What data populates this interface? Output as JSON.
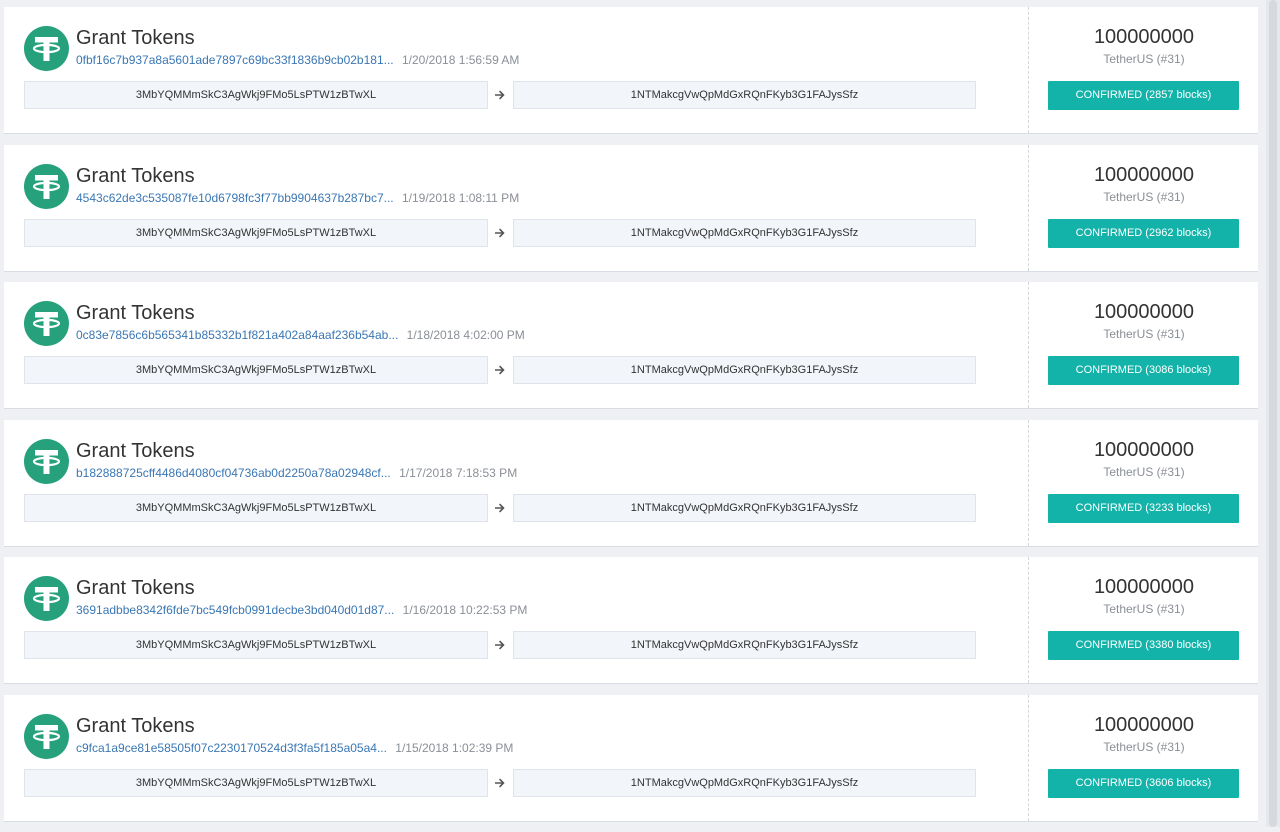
{
  "colors": {
    "tether_green": "#26a17b",
    "confirmed_teal": "#13b3a9",
    "hash_link": "#3a77b4"
  },
  "icons": {
    "logo": "tether-logo-icon",
    "arrow": "arrow-right-icon"
  },
  "transactions": [
    {
      "type": "Grant Tokens",
      "hash": "0fbf16c7b937a8a5601ade7897c69bc33f1836b9cb02b181...",
      "time": "1/20/2018 1:56:59 AM",
      "from": "3MbYQMMmSkC3AgWkj9FMo5LsPTW1zBTwXL",
      "to": "1NTMakcgVwQpMdGxRQnFKyb3G1FAJysSfz",
      "amount": "100000000",
      "currency": "TetherUS (#31)",
      "status": "CONFIRMED (2857 blocks)"
    },
    {
      "type": "Grant Tokens",
      "hash": "4543c62de3c535087fe10d6798fc3f77bb9904637b287bc7...",
      "time": "1/19/2018 1:08:11 PM",
      "from": "3MbYQMMmSkC3AgWkj9FMo5LsPTW1zBTwXL",
      "to": "1NTMakcgVwQpMdGxRQnFKyb3G1FAJysSfz",
      "amount": "100000000",
      "currency": "TetherUS (#31)",
      "status": "CONFIRMED (2962 blocks)"
    },
    {
      "type": "Grant Tokens",
      "hash": "0c83e7856c6b565341b85332b1f821a402a84aaf236b54ab...",
      "time": "1/18/2018 4:02:00 PM",
      "from": "3MbYQMMmSkC3AgWkj9FMo5LsPTW1zBTwXL",
      "to": "1NTMakcgVwQpMdGxRQnFKyb3G1FAJysSfz",
      "amount": "100000000",
      "currency": "TetherUS (#31)",
      "status": "CONFIRMED (3086 blocks)"
    },
    {
      "type": "Grant Tokens",
      "hash": "b182888725cff4486d4080cf04736ab0d2250a78a02948cf...",
      "time": "1/17/2018 7:18:53 PM",
      "from": "3MbYQMMmSkC3AgWkj9FMo5LsPTW1zBTwXL",
      "to": "1NTMakcgVwQpMdGxRQnFKyb3G1FAJysSfz",
      "amount": "100000000",
      "currency": "TetherUS (#31)",
      "status": "CONFIRMED (3233 blocks)"
    },
    {
      "type": "Grant Tokens",
      "hash": "3691adbbe8342f6fde7bc549fcb0991decbe3bd040d01d87...",
      "time": "1/16/2018 10:22:53 PM",
      "from": "3MbYQMMmSkC3AgWkj9FMo5LsPTW1zBTwXL",
      "to": "1NTMakcgVwQpMdGxRQnFKyb3G1FAJysSfz",
      "amount": "100000000",
      "currency": "TetherUS (#31)",
      "status": "CONFIRMED (3380 blocks)"
    },
    {
      "type": "Grant Tokens",
      "hash": "c9fca1a9ce81e58505f07c2230170524d3f3fa5f185a05a4...",
      "time": "1/15/2018 1:02:39 PM",
      "from": "3MbYQMMmSkC3AgWkj9FMo5LsPTW1zBTwXL",
      "to": "1NTMakcgVwQpMdGxRQnFKyb3G1FAJysSfz",
      "amount": "100000000",
      "currency": "TetherUS (#31)",
      "status": "CONFIRMED (3606 blocks)"
    }
  ]
}
